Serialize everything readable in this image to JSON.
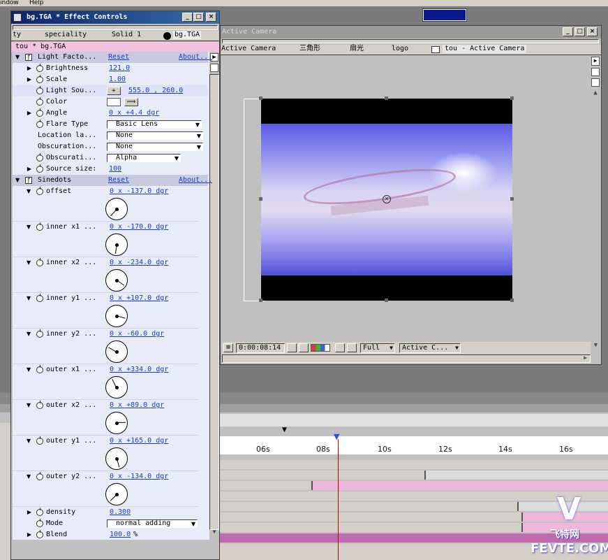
{
  "menu": {
    "left": "indow",
    "help": "Help"
  },
  "top_color_swatch": "#0a1a8c",
  "effect_window": {
    "title": "bg.TGA * Effect Controls",
    "tabs": [
      "ty",
      "speciality",
      "Solid 1",
      "bg.TGA"
    ],
    "breadcrumb": "tou * bg.TGA",
    "light_factory": {
      "name": "Light Facto...",
      "reset": "Reset",
      "about": "About...",
      "rows": [
        {
          "label": "Brightness",
          "value": "121.0"
        },
        {
          "label": "Scale",
          "value": "1.00"
        },
        {
          "label": "Light Sou...",
          "value": "555.0 , 260.0"
        },
        {
          "label": "Color",
          "value": ""
        },
        {
          "label": "Angle",
          "value": "0 x +4.4 dgr"
        },
        {
          "label": "Flare Type",
          "value": "Basic Lens"
        },
        {
          "label": "Location la...",
          "value": "None"
        },
        {
          "label": "Obscuration...",
          "value": "None"
        },
        {
          "label": "Obscurati...",
          "value": "Alpha"
        },
        {
          "label": "Source size:",
          "value": "100"
        }
      ]
    },
    "sinedots": {
      "name": "Sinedots",
      "reset": "Reset",
      "about": "About...",
      "params": [
        {
          "label": "offset",
          "value": "0 x -137.0 dgr",
          "angle": -137
        },
        {
          "label": "inner x1 ...",
          "value": "0 x -170.0 dgr",
          "angle": -170
        },
        {
          "label": "inner x2 ...",
          "value": "0 x -234.0 dgr",
          "angle": -234
        },
        {
          "label": "inner y1 ...",
          "value": "0 x +107.0 dgr",
          "angle": 107
        },
        {
          "label": "inner y2 ...",
          "value": "0 x -60.0 dgr",
          "angle": -60
        },
        {
          "label": "outer x1 ...",
          "value": "0 x +334.0 dgr",
          "angle": 334
        },
        {
          "label": "outer x2 ...",
          "value": "0 x +89.0 dgr",
          "angle": 89
        },
        {
          "label": "outer y1 ...",
          "value": "0 x +165.0 dgr",
          "angle": 165
        },
        {
          "label": "outer y2 ...",
          "value": "0 x -134.0 dgr",
          "angle": -134
        }
      ],
      "density_label": "density",
      "density": "0.300",
      "mode_label": "Mode",
      "mode": "normal adding",
      "blend_label": "Blend",
      "blend": "100.0",
      "blend_unit": "%"
    }
  },
  "comp_window": {
    "title": "Active Camera",
    "tabs": [
      "Active Camera",
      "三角形",
      "扇光",
      "logo",
      "tou - Active Camera"
    ],
    "timecode": "0:00:08:14",
    "resolution": "Full",
    "view": "Active C..."
  },
  "timeline": {
    "ticks": [
      "06s",
      "08s",
      "10s",
      "12s",
      "14s",
      "16s"
    ]
  },
  "watermark": {
    "brand": "FEVTE.COM",
    "cn": "飞特网"
  }
}
